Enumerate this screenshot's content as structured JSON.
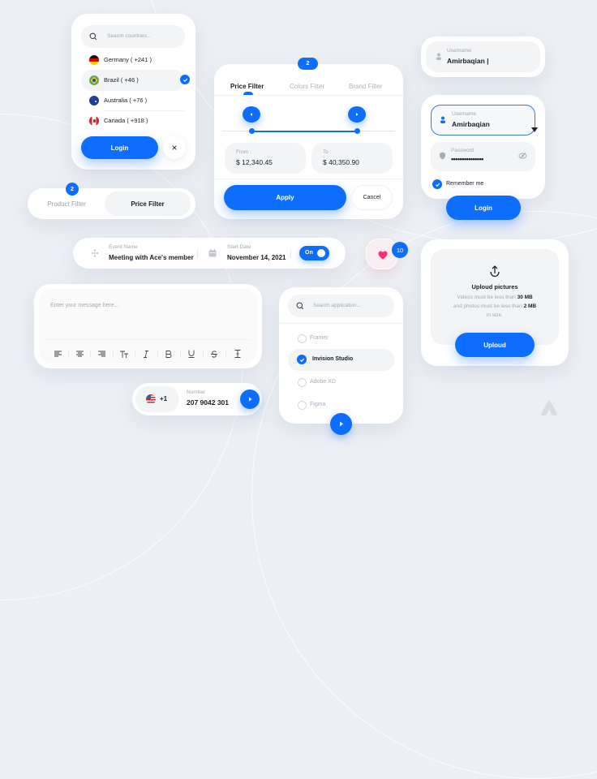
{
  "country_picker": {
    "search_placeholder": "Search countries...",
    "countries": [
      {
        "name": "Germany ( +241 )",
        "flag": "germany-flag",
        "selected": false
      },
      {
        "name": "Brazil ( +46 )",
        "flag": "brazil-flag",
        "selected": true
      },
      {
        "name": "Australia ( +76 )",
        "flag": "australia-flag",
        "selected": false
      },
      {
        "name": "Canada ( +918 )",
        "flag": "canada-flag",
        "selected": false
      }
    ],
    "login_label": "Login",
    "close_icon": "×"
  },
  "filter_toggle": {
    "badge": "2",
    "tabs": [
      {
        "label": "Product Filter",
        "active": false
      },
      {
        "label": "Price Filter",
        "active": true
      }
    ]
  },
  "price_filter": {
    "badge": "2",
    "tabs": [
      {
        "label": "Price Filter",
        "active": true
      },
      {
        "label": "Colors Filter",
        "active": false
      },
      {
        "label": "Brand Filter",
        "active": false
      }
    ],
    "range": {
      "low_fraction": 0.17,
      "high_fraction": 0.78
    },
    "from_label": "From :",
    "from_value": "$ 12,340.45",
    "to_label": "To :",
    "to_value": "$ 40,350.90",
    "apply_label": "Apply",
    "cancel_label": "Cancel"
  },
  "username_field": {
    "label": "Username",
    "value": "Amirbaqian |"
  },
  "login_form": {
    "username_label": "Username",
    "username_value": "Amirbaqian",
    "password_label": "Password",
    "password_value": "•••••••••••••••",
    "remember_label": "Remember me",
    "remember_checked": true,
    "login_label": "Login"
  },
  "event_bar": {
    "event_label": "Event Name",
    "event_value": "Meeting with Ace's member",
    "date_label": "Start Date",
    "date_value": "November 14, 2021",
    "toggle_label": "On",
    "toggle_on": true
  },
  "like_button": {
    "count": "10",
    "heart_color": "#ff2d6f"
  },
  "upload": {
    "title": "Uploud pictures",
    "line1_prefix": "Videos must be less than ",
    "line1_bold": "30 MB",
    "line2_prefix": "and photos must be less than ",
    "line2_bold": "2 MB",
    "line3": "in size.",
    "button_label": "Uploud"
  },
  "message_box": {
    "placeholder": "Enter your message here...",
    "toolbar": [
      "align-left",
      "align-center",
      "align-right",
      "text-size",
      "italic",
      "bold",
      "underline",
      "strikethrough",
      "text-cursor"
    ]
  },
  "app_picker": {
    "search_placeholder": "Search application...",
    "apps": [
      {
        "name": "Framer",
        "selected": false
      },
      {
        "name": "Invision Studio",
        "selected": true
      },
      {
        "name": "Adobe XD",
        "selected": false
      },
      {
        "name": "Figma",
        "selected": false
      }
    ]
  },
  "phone_input": {
    "country_code": "+1",
    "label": "Number",
    "value": "207 9042 301"
  },
  "colors": {
    "accent": "#0d6efd",
    "background": "#eceff4",
    "heart": "#ff2d6f"
  }
}
